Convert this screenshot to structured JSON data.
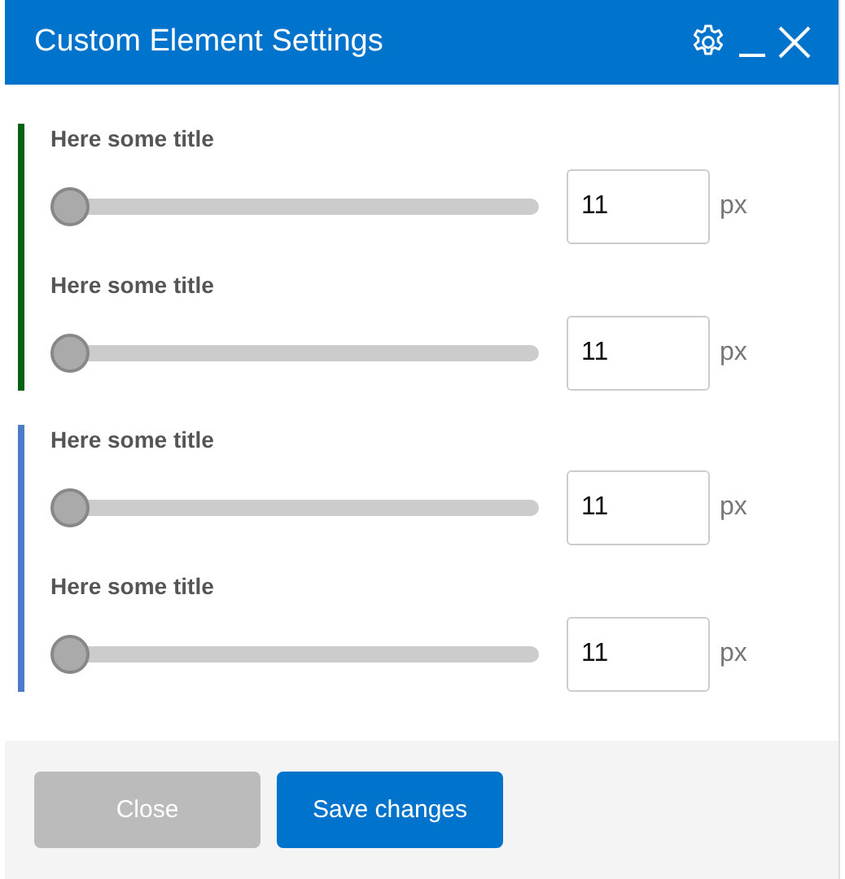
{
  "window": {
    "title": "Custom Element Settings"
  },
  "groups": [
    {
      "color": "#006414",
      "settings": [
        {
          "title": "Here some title",
          "level": 0,
          "value": "11",
          "unit": "px"
        },
        {
          "title": "Here some title",
          "level": 0,
          "value": "11",
          "unit": "px"
        }
      ]
    },
    {
      "color": "#4a7cc9",
      "settings": [
        {
          "title": "Here some title",
          "level": 0,
          "value": "11",
          "unit": "px"
        },
        {
          "title": "Here some title",
          "level": 0,
          "value": "11",
          "unit": "px"
        }
      ]
    }
  ],
  "buttons": [
    {
      "label": "Close",
      "disabled": true
    },
    {
      "label": "Save changes",
      "disabled": false
    }
  ]
}
